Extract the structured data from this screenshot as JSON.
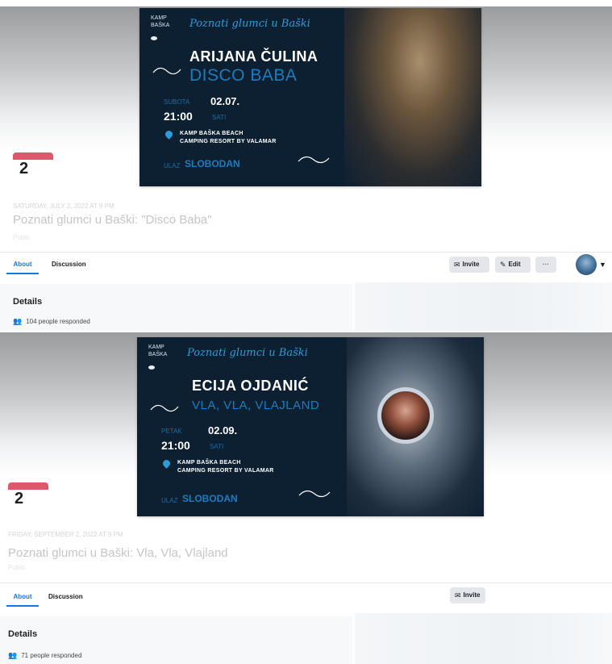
{
  "events": [
    {
      "banner": {
        "logo_text": "KAMP BAŠKA",
        "script_title": "Poznati glumci u Baški",
        "headline": "ARIJANA ČULINA",
        "subheadline": "DISCO BABA",
        "date_label": "SUBOTA",
        "date": "02.07.",
        "time": "21:00",
        "time_label": "SATI",
        "location_line1": "KAMP BAŠKA BEACH",
        "location_line2": "CAMPING RESORT BY VALAMAR",
        "entry_label": "ULAZ",
        "entry": "SLOBODAN"
      },
      "date_badge_day": "2",
      "event_date": "SATURDAY, JULY 2, 2022 AT 9 PM",
      "title": "Poznati glumci u Baški: \"Disco Baba\"",
      "meta": "Public",
      "tabs": [
        {
          "label": "About",
          "active": true
        },
        {
          "label": "Discussion",
          "active": false
        }
      ],
      "actions": {
        "invite": "Invite",
        "edit": "Edit",
        "more": "···"
      },
      "details": {
        "title": "Details",
        "responded": "104 people responded"
      }
    },
    {
      "banner": {
        "logo_text": "KAMP BAŠKA",
        "script_title": "Poznati glumci u Baški",
        "headline": "ECIJA OJDANIĆ",
        "subheadline": "VLA, VLA, VLAJLAND",
        "date_label": "PETAK",
        "date": "02.09.",
        "time": "21:00",
        "time_label": "SATI",
        "location_line1": "KAMP BAŠKA BEACH",
        "location_line2": "CAMPING RESORT BY VALAMAR",
        "entry_label": "ULAZ",
        "entry": "SLOBODAN"
      },
      "date_badge_day": "2",
      "event_date": "FRIDAY, SEPTEMBER 2, 2022 AT 9 PM",
      "title": "Poznati glumci u Baški: Vla, Vla, Vlajland",
      "meta": "Public",
      "tabs": [
        {
          "label": "About",
          "active": true
        },
        {
          "label": "Discussion",
          "active": false
        }
      ],
      "actions": {
        "invite": "Invite"
      },
      "details": {
        "title": "Details",
        "responded": "71 people responded"
      }
    }
  ],
  "colors": {
    "banner_bg": "#0d2032",
    "accent_blue": "#1d7cbf",
    "badge_red": "#e0566a",
    "tab_active": "#1b74e4"
  },
  "icons": {
    "invite": "invite-icon",
    "edit": "pencil-icon",
    "people": "people-icon",
    "location": "location-pin-icon"
  }
}
